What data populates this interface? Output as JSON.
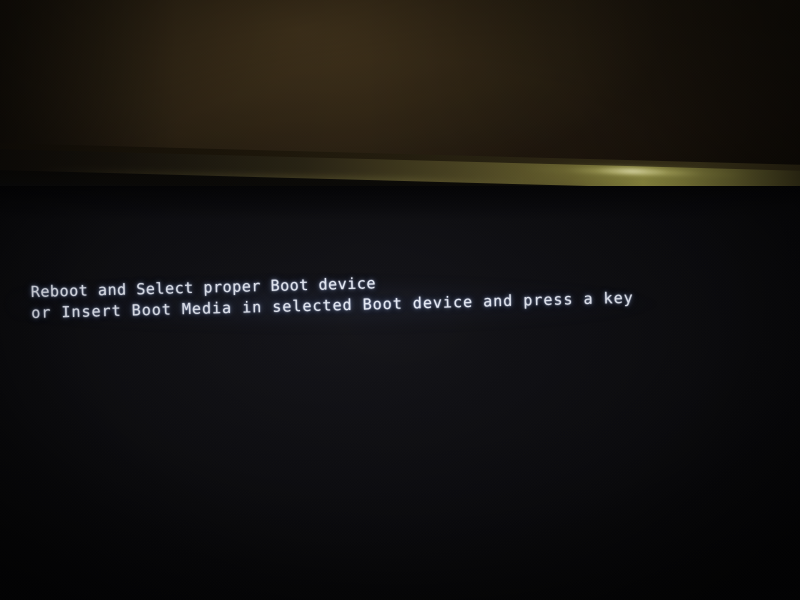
{
  "scene": {
    "kind": "photograph-of-monitor",
    "subject": "BIOS boot failure message on a computer monitor",
    "wall_color": "#2e2414",
    "bezel_color": "#1a150b",
    "bezel_glare_color": "#e4e196",
    "screen_color": "#0d0d10"
  },
  "screen": {
    "text_color": "#e8ecf6",
    "message_lines": [
      "Reboot and Select proper Boot device",
      "or Insert Boot Media in selected Boot device and press a key"
    ],
    "line1": "Reboot and Select proper Boot device",
    "line2": "or Insert Boot Media in selected Boot device and press a key"
  }
}
